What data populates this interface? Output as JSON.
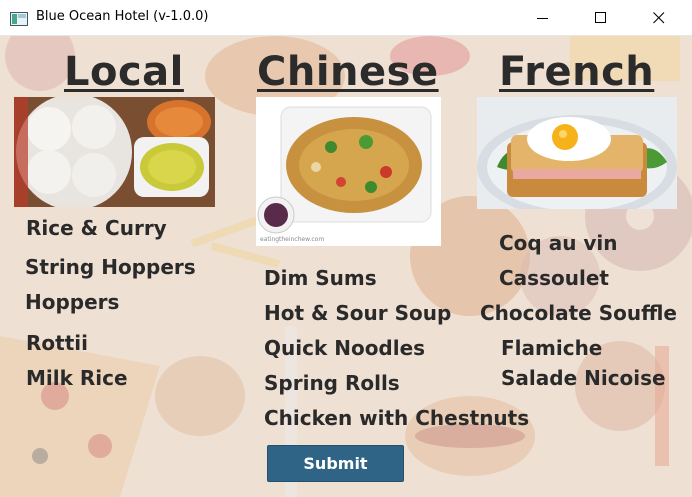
{
  "window": {
    "title": "Blue Ocean Hotel (v-1.0.0)"
  },
  "menu": {
    "local": {
      "heading": "Local",
      "items": [
        "Rice & Curry",
        "String Hoppers",
        "Hoppers",
        "Rottii",
        "Milk Rice"
      ]
    },
    "chinese": {
      "heading": "Chinese",
      "items": [
        "Dim Sums",
        "Hot & Sour Soup",
        "Quick Noodles",
        "Spring Rolls",
        "Chicken with Chestnuts"
      ]
    },
    "french": {
      "heading": "French",
      "items": [
        "Coq au vin",
        "Cassoulet",
        "Chocolate Souffle",
        "Flamiche",
        "Salade Nicoise"
      ]
    }
  },
  "submit_label": "Submit",
  "colors": {
    "heading_text": "#2b2b2b",
    "submit_bg": "#2f6487",
    "submit_text": "#ffffff"
  },
  "icons": [
    "app-icon",
    "minimize-icon",
    "maximize-icon",
    "close-icon"
  ]
}
